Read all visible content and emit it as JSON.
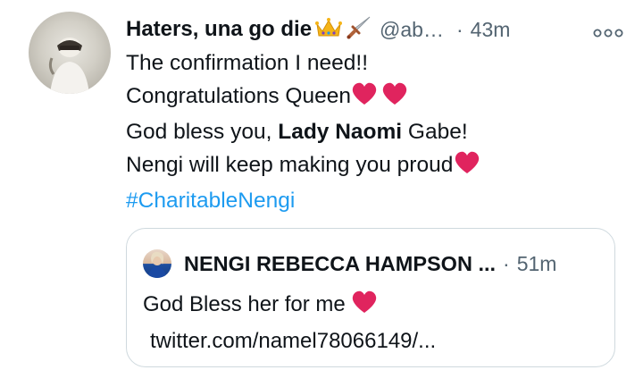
{
  "tweet": {
    "author_name": "Haters, una go die",
    "author_emojis": [
      "crown-emoji",
      "dagger-emoji"
    ],
    "handle": "@ab…",
    "separator": "·",
    "time": "43m",
    "lines": {
      "l1": "The confirmation I need!!",
      "l2": "Congratulations Queen",
      "l3_pre": "God bless you, ",
      "l3_bold": "Lady Naomi",
      "l3_post": " Gabe!",
      "l4": "Nengi will keep making you proud",
      "hashtag": "#CharitableNengi"
    }
  },
  "quoted": {
    "author_name": "NENGI REBECCA HAMPSON ...",
    "separator": "·",
    "time": "51m",
    "text": "God Bless her for me",
    "link": "twitter.com/namel78066149/..."
  },
  "colors": {
    "text": "#0f1419",
    "secondary": "#536471",
    "hashtag": "#1d9bf0",
    "heart": "#e0245e",
    "border": "#cfd9de"
  }
}
